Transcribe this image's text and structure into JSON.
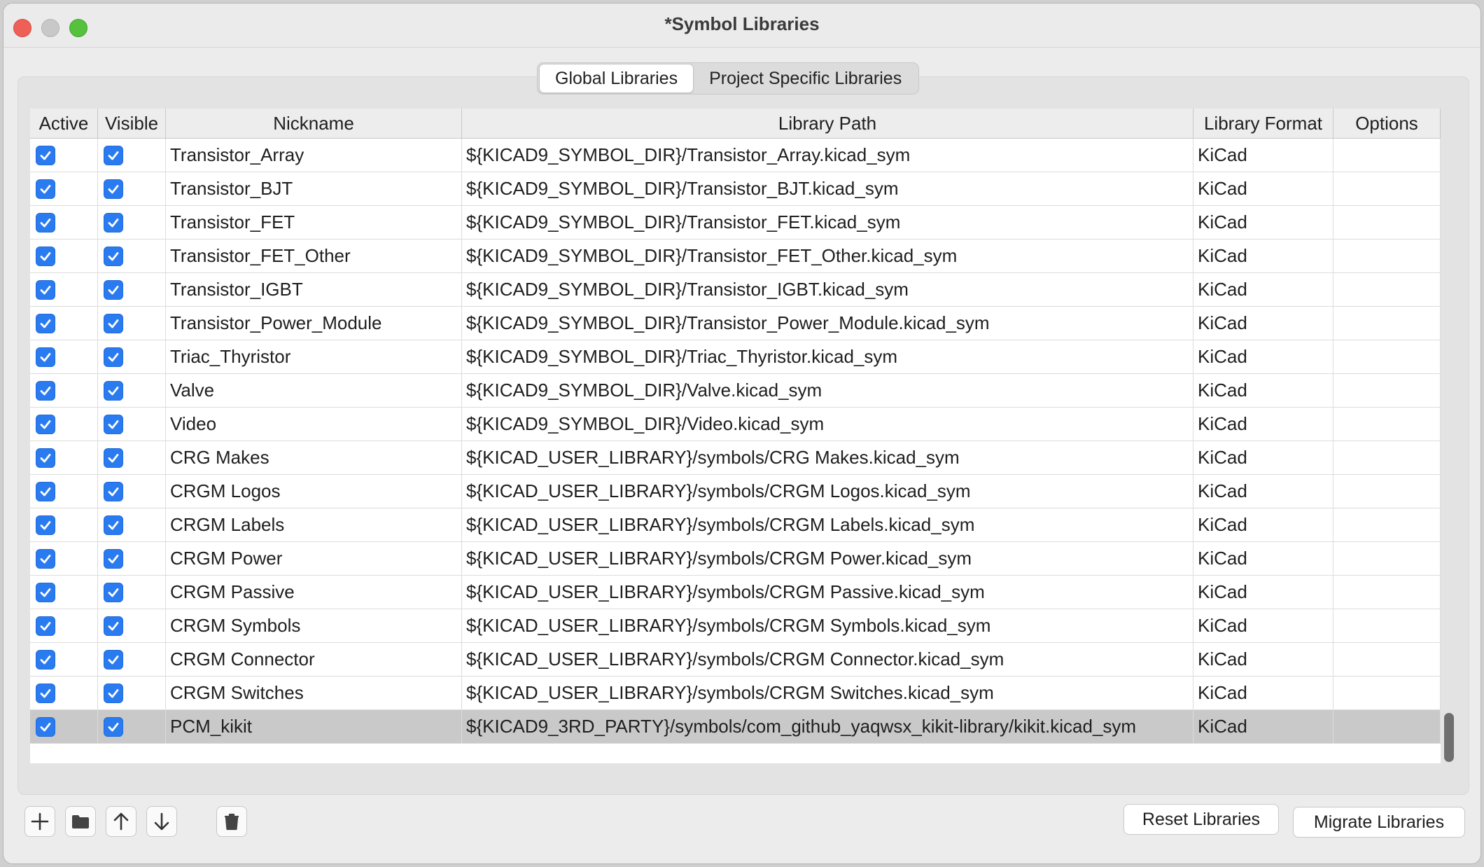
{
  "window": {
    "title": "*Symbol Libraries"
  },
  "tabs": [
    {
      "label": "Global Libraries",
      "active": true
    },
    {
      "label": "Project Specific Libraries",
      "active": false
    }
  ],
  "grid": {
    "columns": [
      "Active",
      "Visible",
      "Nickname",
      "Library Path",
      "Library Format",
      "Options"
    ],
    "rows": [
      {
        "active": true,
        "visible": true,
        "nickname": "Transistor_Array",
        "path": "${KICAD9_SYMBOL_DIR}/Transistor_Array.kicad_sym",
        "format": "KiCad",
        "options": ""
      },
      {
        "active": true,
        "visible": true,
        "nickname": "Transistor_BJT",
        "path": "${KICAD9_SYMBOL_DIR}/Transistor_BJT.kicad_sym",
        "format": "KiCad",
        "options": ""
      },
      {
        "active": true,
        "visible": true,
        "nickname": "Transistor_FET",
        "path": "${KICAD9_SYMBOL_DIR}/Transistor_FET.kicad_sym",
        "format": "KiCad",
        "options": ""
      },
      {
        "active": true,
        "visible": true,
        "nickname": "Transistor_FET_Other",
        "path": "${KICAD9_SYMBOL_DIR}/Transistor_FET_Other.kicad_sym",
        "format": "KiCad",
        "options": ""
      },
      {
        "active": true,
        "visible": true,
        "nickname": "Transistor_IGBT",
        "path": "${KICAD9_SYMBOL_DIR}/Transistor_IGBT.kicad_sym",
        "format": "KiCad",
        "options": ""
      },
      {
        "active": true,
        "visible": true,
        "nickname": "Transistor_Power_Module",
        "path": "${KICAD9_SYMBOL_DIR}/Transistor_Power_Module.kicad_sym",
        "format": "KiCad",
        "options": ""
      },
      {
        "active": true,
        "visible": true,
        "nickname": "Triac_Thyristor",
        "path": "${KICAD9_SYMBOL_DIR}/Triac_Thyristor.kicad_sym",
        "format": "KiCad",
        "options": ""
      },
      {
        "active": true,
        "visible": true,
        "nickname": "Valve",
        "path": "${KICAD9_SYMBOL_DIR}/Valve.kicad_sym",
        "format": "KiCad",
        "options": ""
      },
      {
        "active": true,
        "visible": true,
        "nickname": "Video",
        "path": "${KICAD9_SYMBOL_DIR}/Video.kicad_sym",
        "format": "KiCad",
        "options": ""
      },
      {
        "active": true,
        "visible": true,
        "nickname": "CRG Makes",
        "path": "${KICAD_USER_LIBRARY}/symbols/CRG Makes.kicad_sym",
        "format": "KiCad",
        "options": ""
      },
      {
        "active": true,
        "visible": true,
        "nickname": "CRGM Logos",
        "path": "${KICAD_USER_LIBRARY}/symbols/CRGM Logos.kicad_sym",
        "format": "KiCad",
        "options": ""
      },
      {
        "active": true,
        "visible": true,
        "nickname": "CRGM Labels",
        "path": "${KICAD_USER_LIBRARY}/symbols/CRGM Labels.kicad_sym",
        "format": "KiCad",
        "options": ""
      },
      {
        "active": true,
        "visible": true,
        "nickname": "CRGM Power",
        "path": "${KICAD_USER_LIBRARY}/symbols/CRGM Power.kicad_sym",
        "format": "KiCad",
        "options": ""
      },
      {
        "active": true,
        "visible": true,
        "nickname": "CRGM Passive",
        "path": "${KICAD_USER_LIBRARY}/symbols/CRGM Passive.kicad_sym",
        "format": "KiCad",
        "options": ""
      },
      {
        "active": true,
        "visible": true,
        "nickname": "CRGM Symbols",
        "path": "${KICAD_USER_LIBRARY}/symbols/CRGM Symbols.kicad_sym",
        "format": "KiCad",
        "options": ""
      },
      {
        "active": true,
        "visible": true,
        "nickname": "CRGM Connector",
        "path": "${KICAD_USER_LIBRARY}/symbols/CRGM Connector.kicad_sym",
        "format": "KiCad",
        "options": ""
      },
      {
        "active": true,
        "visible": true,
        "nickname": "CRGM Switches",
        "path": "${KICAD_USER_LIBRARY}/symbols/CRGM Switches.kicad_sym",
        "format": "KiCad",
        "options": ""
      },
      {
        "active": true,
        "visible": true,
        "nickname": "PCM_kikit",
        "path": "${KICAD9_3RD_PARTY}/symbols/com_github_yaqwsx_kikit-library/kikit.kicad_sym",
        "format": "KiCad",
        "options": "",
        "selected": true
      }
    ]
  },
  "toolbar": {
    "icons": [
      "add-icon",
      "folder-icon",
      "arrow-up-icon",
      "arrow-down-icon",
      "trash-icon"
    ],
    "reset_label": "Reset Libraries",
    "migrate_label": "Migrate Libraries"
  },
  "colors": {
    "checkbox": "#2b7bf0",
    "selected_row": "#c9c9c9"
  }
}
